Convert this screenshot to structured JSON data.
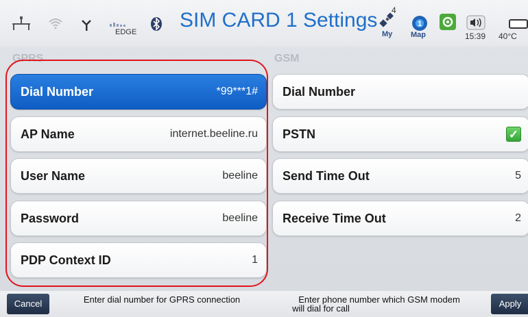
{
  "status": {
    "title": "SIM CARD 1 Settings",
    "network_label": "EDGE",
    "gps_count": "4",
    "my_label": "My",
    "map_label": "Map",
    "time": "15:39",
    "temperature": "40°C"
  },
  "sections": {
    "gprs": "GPRS",
    "gsm": "GSM"
  },
  "gprs_rows": [
    {
      "label": "Dial Number",
      "value": "*99***1#"
    },
    {
      "label": "AP Name",
      "value": "internet.beeline.ru"
    },
    {
      "label": "User Name",
      "value": "beeline"
    },
    {
      "label": "Password",
      "value": "beeline"
    },
    {
      "label": "PDP Context ID",
      "value": "1"
    }
  ],
  "gsm_rows": [
    {
      "label": "Dial Number",
      "value": ""
    },
    {
      "label": "PSTN",
      "value": ""
    },
    {
      "label": "Send Time Out",
      "value": "5"
    },
    {
      "label": "Receive Time Out",
      "value": "2"
    }
  ],
  "bottom": {
    "cancel": "Cancel",
    "apply": "Apply",
    "hint_left": "Enter dial number for GPRS connection",
    "hint_right_line1": "Enter phone number which GSM modem",
    "hint_right_line2": "will dial for call"
  },
  "colors": {
    "accent": "#1f6fc9",
    "selected_row": "#1a66d0",
    "highlight": "#e0141c",
    "check": "#3fb43e"
  }
}
